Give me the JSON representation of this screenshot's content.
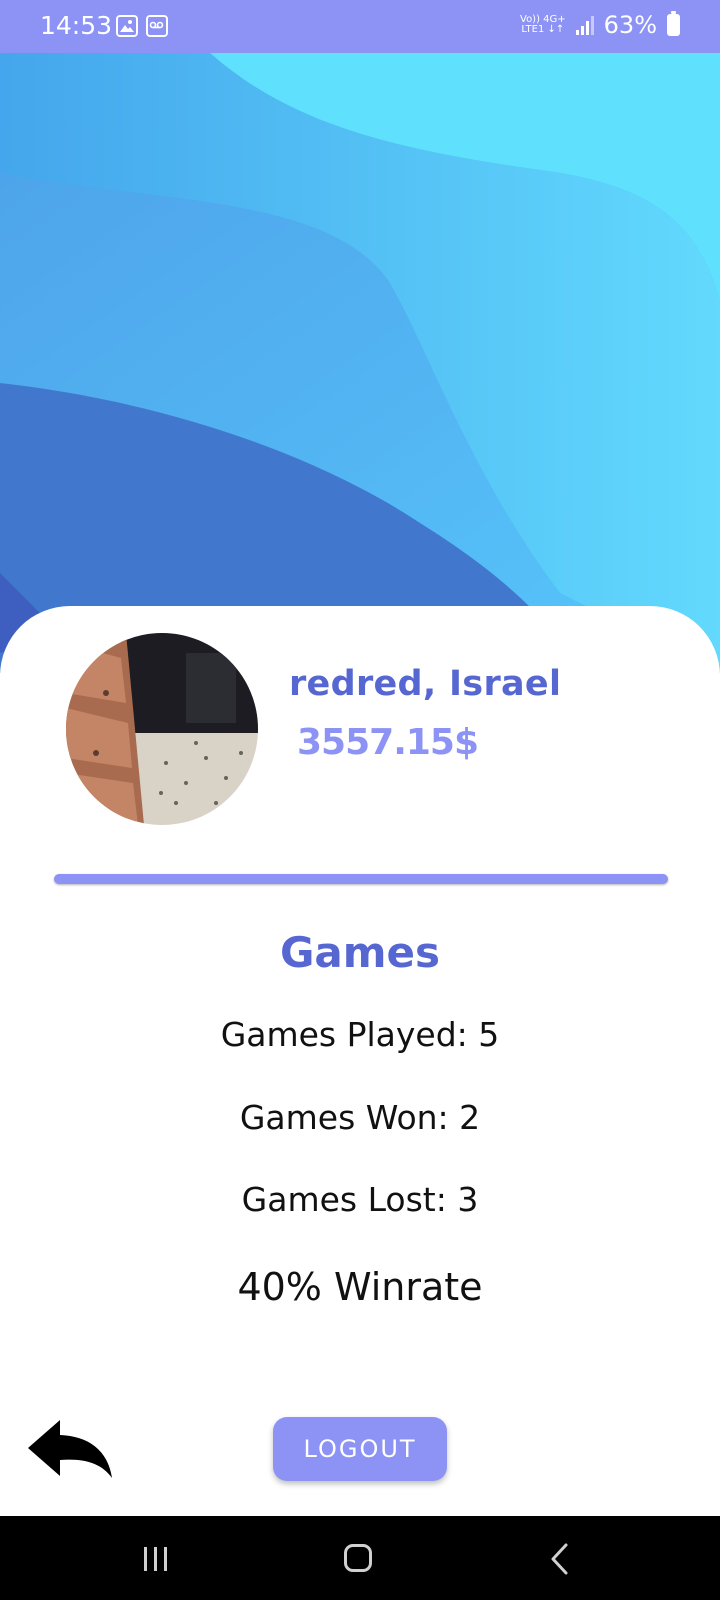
{
  "status_bar": {
    "time": "14:53",
    "network_top": "Vo)) 4G+",
    "network_bottom": "LTE1 ↓↑",
    "battery_percent": "63%"
  },
  "profile": {
    "name": "redred, Israel",
    "balance": "3557.15$"
  },
  "games": {
    "title": "Games",
    "played": "Games Played: 5",
    "won": "Games Won: 2",
    "lost": "Games Lost: 3",
    "winrate": "40% Winrate"
  },
  "actions": {
    "logout_label": "LOGOUT"
  },
  "colors": {
    "accent": "#8c93f5",
    "title_blue": "#5667d2"
  },
  "icons": {
    "back": "back-arrow-icon",
    "nav_recents": "recents-icon",
    "nav_home": "home-icon",
    "nav_back": "nav-back-icon"
  }
}
